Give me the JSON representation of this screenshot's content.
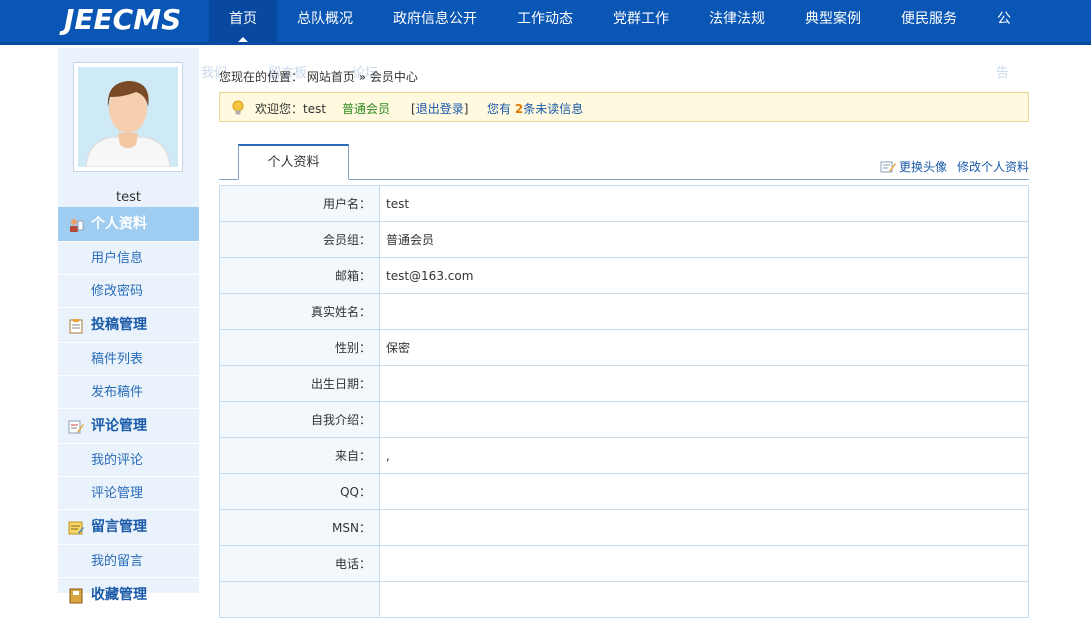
{
  "header": {
    "logo": "JEECMS",
    "nav": [
      "首页",
      "总队概况",
      "政府信息公开",
      "工作动态",
      "党群工作",
      "法律法规",
      "典型案例",
      "便民服务",
      "公"
    ],
    "ghost_items": [
      "我们",
      "留言板",
      "论坛",
      "告"
    ]
  },
  "sidebar": {
    "username": "test",
    "menu": [
      {
        "type": "head",
        "label": "个人资料",
        "icon": "user-icon",
        "active": true
      },
      {
        "type": "sub",
        "label": "用户信息"
      },
      {
        "type": "sub",
        "label": "修改密码"
      },
      {
        "type": "head",
        "label": "投稿管理",
        "icon": "clipboard-icon"
      },
      {
        "type": "sub",
        "label": "稿件列表"
      },
      {
        "type": "sub",
        "label": "发布稿件"
      },
      {
        "type": "head",
        "label": "评论管理",
        "icon": "comment-edit-icon"
      },
      {
        "type": "sub",
        "label": "我的评论"
      },
      {
        "type": "sub",
        "label": "评论管理"
      },
      {
        "type": "head",
        "label": "留言管理",
        "icon": "message-icon"
      },
      {
        "type": "sub",
        "label": "我的留言"
      },
      {
        "type": "head",
        "label": "收藏管理",
        "icon": "bookmark-icon"
      }
    ]
  },
  "breadcrumb": {
    "prefix": "您现在的位置：",
    "home": "网站首页",
    "sep": "»",
    "current": "会员中心"
  },
  "welcome": {
    "greeting": "欢迎您：test",
    "level": "普通会员",
    "logout_open": "[",
    "logout": "退出登录",
    "logout_close": "]",
    "msg_before": "您有 ",
    "msg_count": "2",
    "msg_after": "条未读信息"
  },
  "tabs": {
    "active": "个人资料",
    "change_avatar": "更换头像",
    "edit_profile": "修改个人资料"
  },
  "profile_rows": [
    {
      "label": "用户名：",
      "value": "test"
    },
    {
      "label": "会员组：",
      "value": "普通会员"
    },
    {
      "label": "邮箱：",
      "value": "test@163.com"
    },
    {
      "label": "真实姓名：",
      "value": ""
    },
    {
      "label": "性别：",
      "value": "保密"
    },
    {
      "label": "出生日期：",
      "value": ""
    },
    {
      "label": "自我介绍：",
      "value": ""
    },
    {
      "label": "来自：",
      "value": ","
    },
    {
      "label": "QQ：",
      "value": ""
    },
    {
      "label": "MSN：",
      "value": ""
    },
    {
      "label": "电话：",
      "value": ""
    },
    {
      "label": "",
      "value": ""
    }
  ],
  "colors": {
    "nav_bg": "#0a56b5",
    "sidebar_bg": "#eaf3fb",
    "active_menu": "#9fcdf2",
    "link": "#1a5aa8",
    "level_green": "#2e8b1f",
    "count_orange": "#e07b00"
  }
}
